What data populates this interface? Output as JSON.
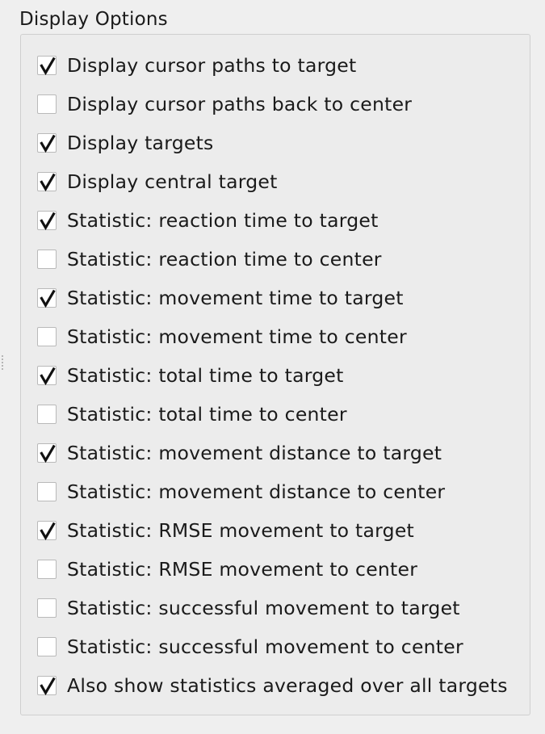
{
  "group": {
    "title": "Display Options"
  },
  "options": [
    {
      "label": "Display cursor paths to target",
      "checked": true
    },
    {
      "label": "Display cursor paths back to center",
      "checked": false
    },
    {
      "label": "Display targets",
      "checked": true
    },
    {
      "label": "Display central target",
      "checked": true
    },
    {
      "label": "Statistic: reaction time to target",
      "checked": true
    },
    {
      "label": "Statistic: reaction time to center",
      "checked": false
    },
    {
      "label": "Statistic: movement time to target",
      "checked": true
    },
    {
      "label": "Statistic: movement time to center",
      "checked": false
    },
    {
      "label": "Statistic: total time to target",
      "checked": true
    },
    {
      "label": "Statistic: total time to center",
      "checked": false
    },
    {
      "label": "Statistic: movement distance to target",
      "checked": true
    },
    {
      "label": "Statistic: movement distance to center",
      "checked": false
    },
    {
      "label": "Statistic: RMSE movement to target",
      "checked": true
    },
    {
      "label": "Statistic: RMSE movement to center",
      "checked": false
    },
    {
      "label": "Statistic: successful movement to target",
      "checked": false
    },
    {
      "label": "Statistic: successful movement to center",
      "checked": false
    },
    {
      "label": "Also show statistics averaged over all targets",
      "checked": true
    }
  ],
  "icons": {
    "check": "checkmark-icon",
    "splitter": "splitter-handle-icon"
  },
  "colors": {
    "background": "#efefef",
    "frame_border": "#cfcfcf",
    "checkbox_border": "#b9b9b9",
    "checkmark": "#111111"
  }
}
